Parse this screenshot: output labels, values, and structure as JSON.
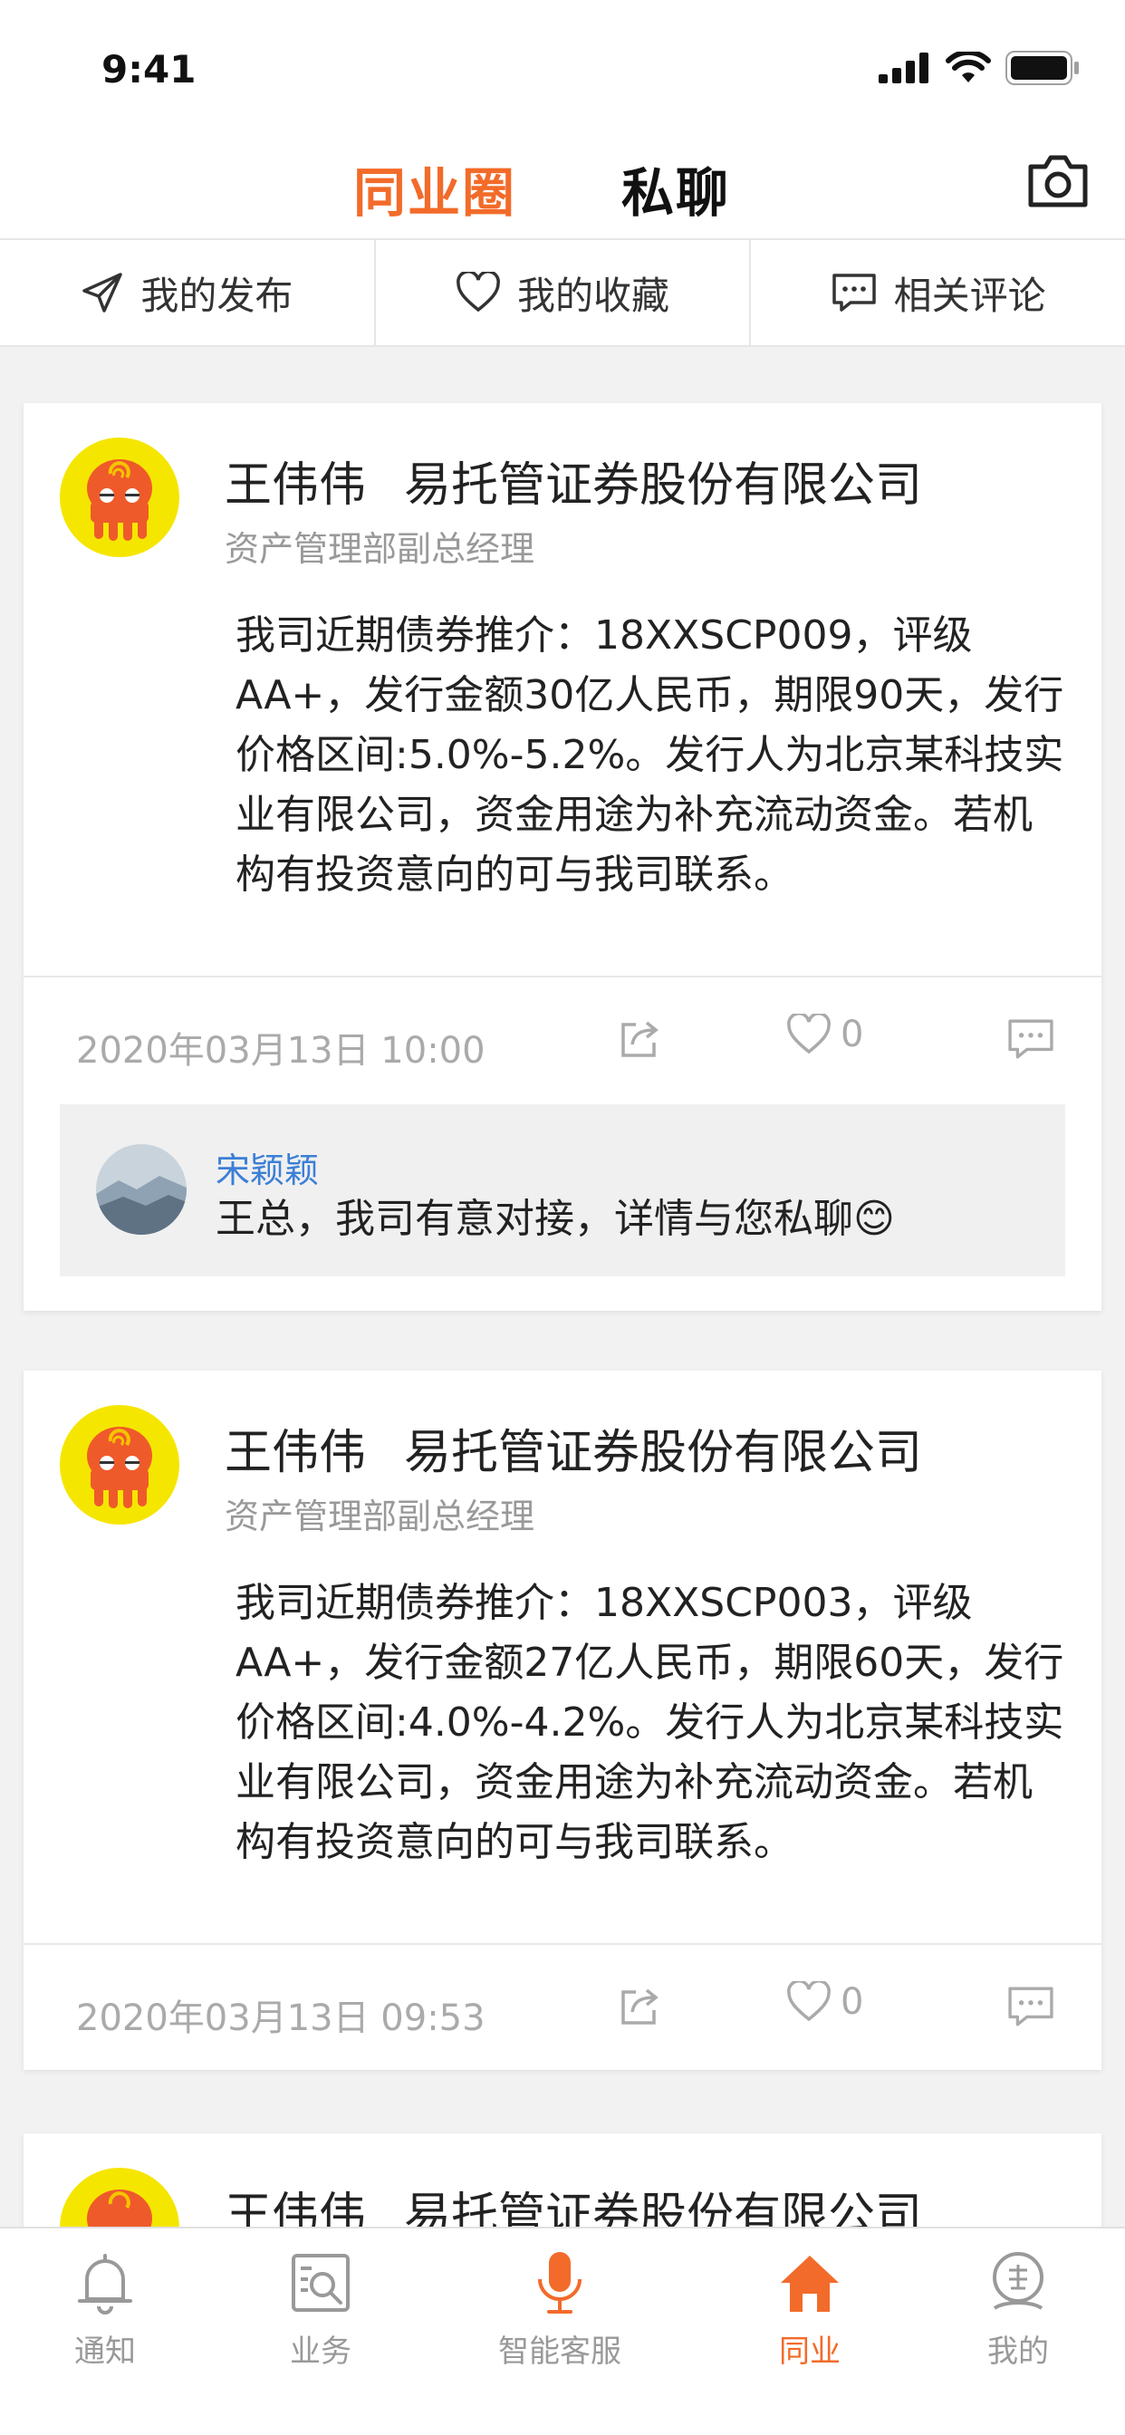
{
  "status": {
    "time": "9:41"
  },
  "header": {
    "tab_peer": "同业圈",
    "tab_chat": "私聊"
  },
  "subnav": [
    {
      "label": "我的发布"
    },
    {
      "label": "我的收藏"
    },
    {
      "label": "相关评论"
    }
  ],
  "posts": [
    {
      "name": "王伟伟",
      "company": "易托管证券股份有限公司",
      "title": "资产管理部副总经理",
      "text": "我司近期债券推介：18XXSCP009，评级AA+，发行金额30亿人民币，期限90天，发行价格区间:5.0%-5.2%。发行人为北京某科技实业有限公司，资金用途为补充流动资金。若机构有投资意向的可与我司联系。",
      "date": "2020年03月13日  10:00",
      "likes": "0",
      "comment": {
        "user": "宋颖颖",
        "text": "王总，我司有意对接，详情与您私聊😊"
      }
    },
    {
      "name": "王伟伟",
      "company": "易托管证券股份有限公司",
      "title": "资产管理部副总经理",
      "text": "我司近期债券推介：18XXSCP003，评级AA+，发行金额27亿人民币，期限60天，发行价格区间:4.0%-4.2%。发行人为北京某科技实业有限公司，资金用途为补充流动资金。若机构有投资意向的可与我司联系。",
      "date": "2020年03月13日  09:53",
      "likes": "0"
    },
    {
      "name": "王伟伟",
      "company": "易托管证券股份有限公司"
    }
  ],
  "bottom_nav": [
    {
      "label": "通知"
    },
    {
      "label": "业务"
    },
    {
      "label": "智能客服"
    },
    {
      "label": "同业"
    },
    {
      "label": "我的"
    }
  ],
  "colors": {
    "accent": "#f26b2a",
    "link": "#3c7fd6",
    "avatar_bg": "#f5e600"
  }
}
